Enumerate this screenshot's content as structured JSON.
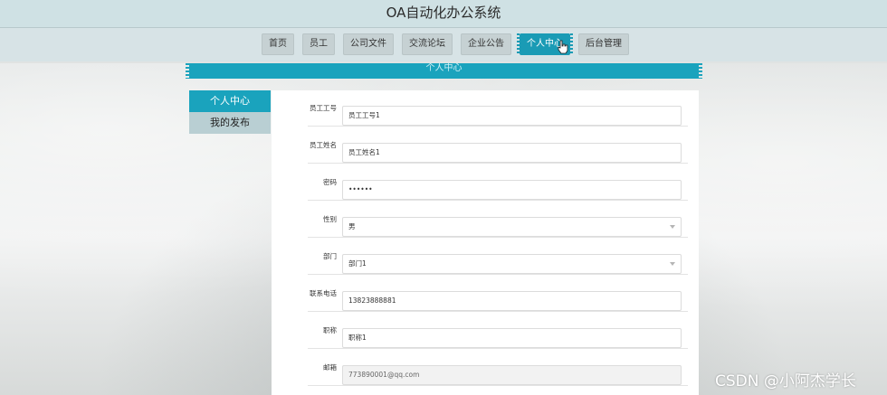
{
  "app": {
    "title": "OA自动化办公系统"
  },
  "nav": {
    "items": [
      {
        "label": "首页"
      },
      {
        "label": "员工"
      },
      {
        "label": "公司文件"
      },
      {
        "label": "交流论坛"
      },
      {
        "label": "企业公告"
      },
      {
        "label": "个人中心",
        "active": true
      },
      {
        "label": "后台管理"
      }
    ]
  },
  "page": {
    "heading": "个人中心"
  },
  "sidebar": {
    "items": [
      {
        "label": "个人中心",
        "active": true
      },
      {
        "label": "我的发布"
      }
    ]
  },
  "form": {
    "employee_id": {
      "label": "员工工号",
      "value": "员工工号1"
    },
    "employee_name": {
      "label": "员工姓名",
      "value": "员工姓名1"
    },
    "password": {
      "label": "密码",
      "value": "••••••"
    },
    "gender": {
      "label": "性别",
      "value": "男"
    },
    "department": {
      "label": "部门",
      "value": "部门1"
    },
    "phone": {
      "label": "联系电话",
      "value": "13823888881"
    },
    "job_title": {
      "label": "职称",
      "value": "职称1"
    },
    "email": {
      "label": "邮箱",
      "value": "773890001@qq.com"
    }
  },
  "watermark": "CSDN @小阿杰学长",
  "colors": {
    "accent": "#1aa3bd",
    "nav_bg": "#d7e3e6",
    "sidebar_bg": "#b9cfd3"
  },
  "icons": {
    "cursor": "hand-pointer-icon",
    "select_arrow": "chevron-down-icon"
  }
}
